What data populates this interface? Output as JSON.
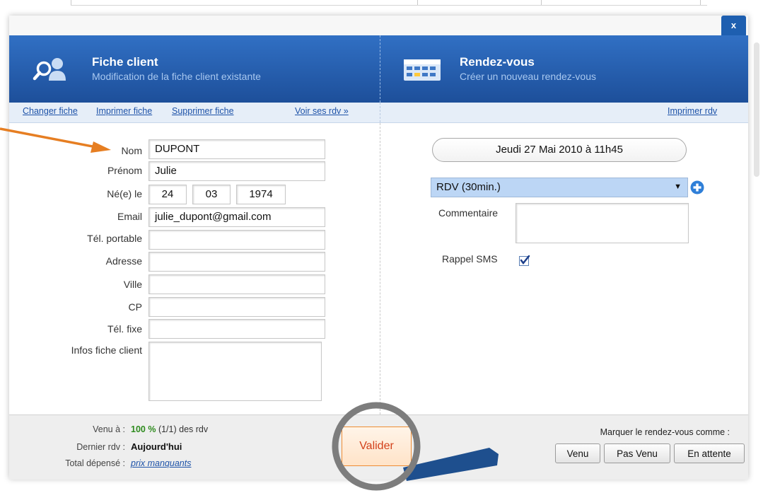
{
  "modal": {
    "close_label": "x"
  },
  "client_header": {
    "title": "Fiche client",
    "subtitle": "Modification de la fiche client existante"
  },
  "rdv_header": {
    "title": "Rendez-vous",
    "subtitle": "Créer un nouveau rendez-vous"
  },
  "client_links": {
    "change": "Changer fiche",
    "print": "Imprimer fiche",
    "delete": "Supprimer fiche",
    "view_rdv": "Voir ses rdv »"
  },
  "rdv_links": {
    "print": "Imprimer rdv"
  },
  "form": {
    "nom": {
      "label": "Nom",
      "value": "DUPONT"
    },
    "prenom": {
      "label": "Prénom",
      "value": "Julie"
    },
    "naissance": {
      "label": "Né(e) le",
      "day": "24",
      "month": "03",
      "year": "1974"
    },
    "email": {
      "label": "Email",
      "value": "julie_dupont@gmail.com"
    },
    "tel_portable": {
      "label": "Tél. portable",
      "value": ""
    },
    "adresse": {
      "label": "Adresse",
      "value": ""
    },
    "ville": {
      "label": "Ville",
      "value": ""
    },
    "cp": {
      "label": "CP",
      "value": ""
    },
    "tel_fixe": {
      "label": "Tél. fixe",
      "value": ""
    },
    "infos": {
      "label": "Infos fiche client",
      "value": ""
    }
  },
  "rdv": {
    "date": "Jeudi 27 Mai 2010 à 11h45",
    "type_selected": "RDV (30min.)",
    "comment_label": "Commentaire",
    "comment_value": "",
    "sms_label": "Rappel SMS",
    "sms_checked": true
  },
  "footer": {
    "venu_label": "Venu à :",
    "venu_percent": "100 %",
    "venu_rest": "(1/1) des rdv",
    "dernier_label": "Dernier rdv :",
    "dernier_value": "Aujourd'hui",
    "total_label": "Total dépensé :",
    "total_value": "prix manquants",
    "validate_label": "Valider",
    "mark_label": "Marquer le rendez-vous comme :",
    "btn_venu": "Venu",
    "btn_pas_venu": "Pas Venu",
    "btn_attente": "En attente"
  },
  "colors": {
    "header_blue": "#1d4f9a",
    "annotation_orange": "#e67e22",
    "success_green": "#2e8b1e",
    "highlight_select": "#bcd6f5"
  },
  "icons": {
    "client": "user-search-icon",
    "calendar": "calendar-icon",
    "add": "plus-circle-icon",
    "sms": "checkbox-checked-icon",
    "annotation": "arrow-icon"
  }
}
